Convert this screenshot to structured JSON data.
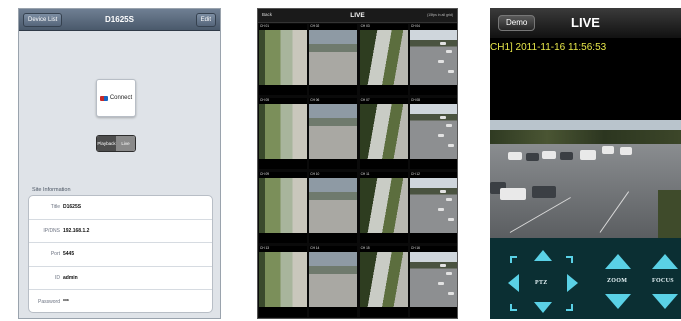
{
  "panel1": {
    "left_button": "Device List",
    "title": "D1625S",
    "right_button": "Edit",
    "connect_label": "Connect",
    "segment": {
      "playback": "Playback",
      "live": "Live"
    },
    "section_title": "Site Information",
    "fields": [
      {
        "key": "Title",
        "value": "D1625S"
      },
      {
        "key": "IP/DNS",
        "value": "192.168.1.2"
      },
      {
        "key": "Port",
        "value": "5445"
      },
      {
        "key": "ID",
        "value": "admin"
      },
      {
        "key": "Password",
        "value": "***"
      }
    ]
  },
  "panel2": {
    "back_label": "Back",
    "title": "LIVE",
    "status": "(15fps in all grid)",
    "channels": [
      "CH 01",
      "CH 02",
      "CH 03",
      "CH 04",
      "CH 05",
      "CH 06",
      "CH 07",
      "CH 08",
      "CH 09",
      "CH 10",
      "CH 11",
      "CH 12",
      "CH 13",
      "CH 14",
      "CH 15",
      "CH 16"
    ]
  },
  "panel3": {
    "demo_label": "Demo",
    "title": "LIVE",
    "timestamp": "CH1] 2011-11-16 11:56:53",
    "ptz_label": "PTZ",
    "zoom_label": "ZOOM",
    "focus_label": "FOCUS"
  },
  "colors": {
    "ptz_arrow": "#5ad1e6",
    "ptz_panel_bg": "#0b2f33",
    "timestamp": "#e8e84a",
    "nav_bar": "#4a596b"
  }
}
